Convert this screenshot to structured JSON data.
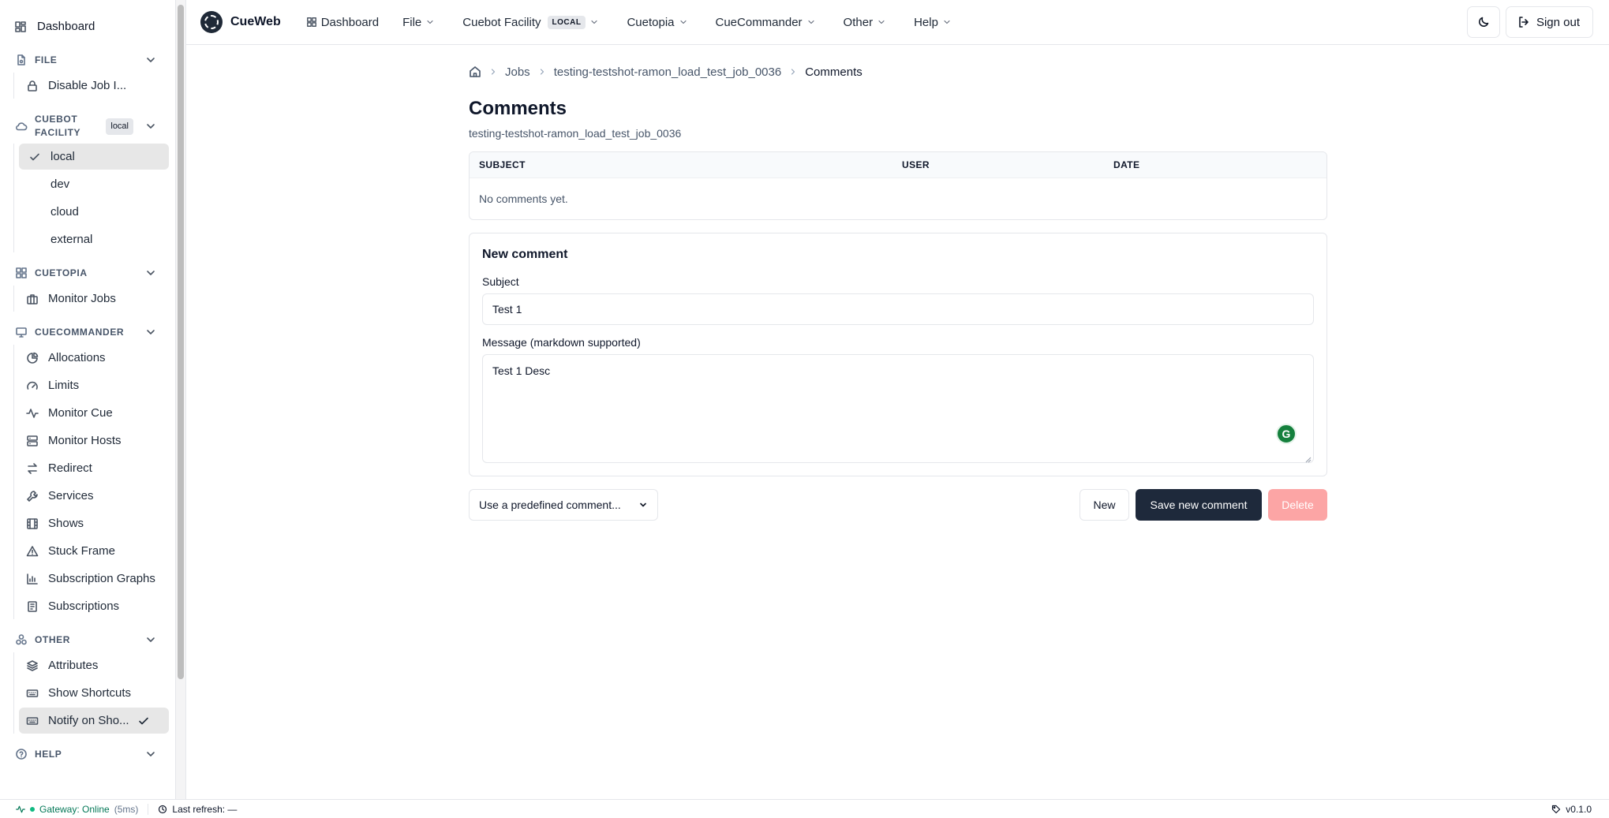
{
  "sidebar": {
    "dashboard": "Dashboard",
    "file": {
      "title": "FILE",
      "items": [
        "Disable Job I..."
      ]
    },
    "cuebot": {
      "title_line1": "CUEBOT",
      "title_line2": "FACILITY",
      "badge": "local",
      "items": [
        "local",
        "dev",
        "cloud",
        "external"
      ],
      "selected": "local"
    },
    "cuetopia": {
      "title": "CUETOPIA",
      "items": [
        "Monitor Jobs"
      ]
    },
    "cuecommander": {
      "title": "CUECOMMANDER",
      "items": [
        "Allocations",
        "Limits",
        "Monitor Cue",
        "Monitor Hosts",
        "Redirect",
        "Services",
        "Shows",
        "Stuck Frame",
        "Subscription Graphs",
        "Subscriptions"
      ]
    },
    "other": {
      "title": "OTHER",
      "items": [
        "Attributes",
        "Show Shortcuts",
        "Notify on Sho..."
      ]
    },
    "help": {
      "title": "HELP"
    }
  },
  "topbar": {
    "brand": "CueWeb",
    "nav": {
      "dashboard": "Dashboard",
      "file": "File",
      "cuebot": "Cuebot Facility",
      "cuebot_badge": "LOCAL",
      "cuetopia": "Cuetopia",
      "cuecommander": "CueCommander",
      "other": "Other",
      "help": "Help"
    },
    "sign_out": "Sign out"
  },
  "breadcrumb": {
    "jobs": "Jobs",
    "job": "testing-testshot-ramon_load_test_job_0036",
    "current": "Comments"
  },
  "page": {
    "title": "Comments",
    "subtitle": "testing-testshot-ramon_load_test_job_0036"
  },
  "table": {
    "headers": [
      "SUBJECT",
      "USER",
      "DATE"
    ],
    "empty": "No comments yet."
  },
  "form": {
    "title": "New comment",
    "subject_label": "Subject",
    "subject_value": "Test 1",
    "message_label": "Message (markdown supported)",
    "message_value": "Test 1 Desc",
    "grammarly": "G"
  },
  "actions": {
    "predefined": "Use a predefined comment...",
    "new": "New",
    "save": "Save new comment",
    "delete": "Delete"
  },
  "status": {
    "gateway": "Gateway: Online",
    "latency": "(5ms)",
    "refresh": "Last refresh: —",
    "version": "v0.1.0"
  },
  "colors": {
    "primary": "#1e293b",
    "danger_disabled": "#fca5a5",
    "online": "#047857"
  }
}
